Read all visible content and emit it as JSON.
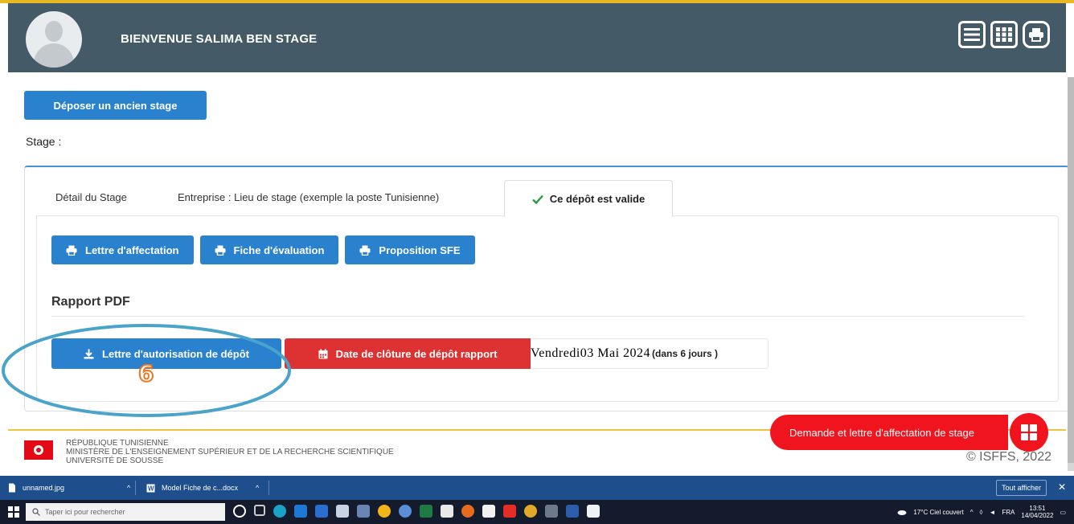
{
  "header": {
    "welcome": "BIENVENUE SALIMA BEN STAGE"
  },
  "main": {
    "deposer_button": "Déposer un ancien stage",
    "stage_label": "Stage :",
    "tabs": [
      {
        "label": "Détail du Stage"
      },
      {
        "label": "Entreprise : Lieu de stage (exemple la poste Tunisienne)"
      },
      {
        "label": "Ce dépôt est valide"
      }
    ],
    "documents": [
      {
        "label": "Lettre d'affectation"
      },
      {
        "label": "Fiche d'évaluation"
      },
      {
        "label": "Proposition SFE"
      }
    ],
    "rapport_title": "Rapport PDF",
    "lettre_autorisation": "Lettre d'autorisation de dépôt",
    "cloture_label": "Date de clôture de dépôt rapport",
    "cloture_date": "Vendredi03 Mai 2024",
    "cloture_remaining": "(dans 6 jours )"
  },
  "annotation": {
    "number": "6"
  },
  "footer": {
    "line1": "RÉPUBLIQUE TUNISIENNE",
    "line2": "MINISTÈRE DE L'ENSEIGNEMENT SUPÉRIEUR ET DE LA RECHERCHE SCIENTIFIQUE",
    "line3": "UNIVERSITÉ DE SOUSSE",
    "copyright": "© ISFFS, 2022",
    "demande_button": "Demande et lettre d'affectation de stage"
  },
  "downloads": {
    "item1": "unnamed.jpg",
    "item2": "Model Fiche de c...docx",
    "show_all": "Tout afficher"
  },
  "taskbar": {
    "search_placeholder": "Taper ici pour rechercher",
    "weather": "17°C Ciel couvert",
    "lang": "FRA",
    "time": "13:51",
    "date": "14/04/2022"
  },
  "colors": {
    "header": "#445a66",
    "primary": "#2a82cf",
    "danger": "#dc3232",
    "annotation": "#4aa3c8"
  }
}
